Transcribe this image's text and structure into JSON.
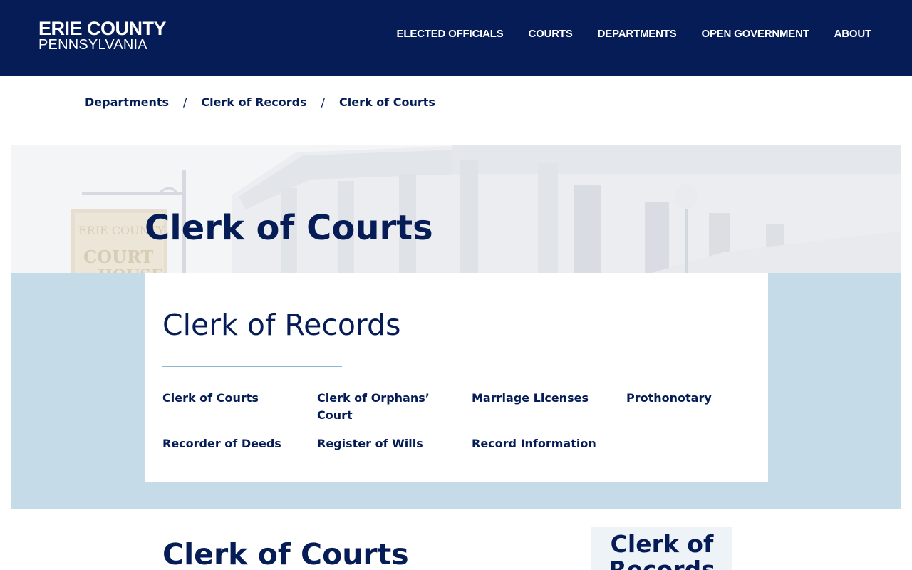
{
  "header": {
    "logo_line1": "ERIE COUNTY",
    "logo_line2": "PENNSYLVANIA",
    "nav": [
      "ELECTED OFFICIALS",
      "COURTS",
      "DEPARTMENTS",
      "OPEN GOVERNMENT",
      "ABOUT"
    ]
  },
  "breadcrumb": {
    "items": [
      "Departments",
      "Clerk of Records",
      "Clerk of Courts"
    ],
    "separator": "/"
  },
  "hero": {
    "title": "Clerk of Courts",
    "sign_line1": "ERIE COUNTY",
    "sign_line2": "COURT",
    "sign_line3": "HOUSE"
  },
  "section_card": {
    "title": "Clerk of Records",
    "links": [
      "Clerk of Courts",
      "Clerk of Orphans’ Court",
      "Marriage Licenses",
      "Prothonotary",
      "Recorder of Deeds",
      "Register of Wills",
      "Record Information"
    ]
  },
  "main": {
    "title": "Clerk of Courts"
  },
  "sidebar": {
    "title": "Clerk of Records"
  },
  "colors": {
    "navy": "#051c56",
    "band": "#c5dce8",
    "rule": "#8eb7cf"
  }
}
